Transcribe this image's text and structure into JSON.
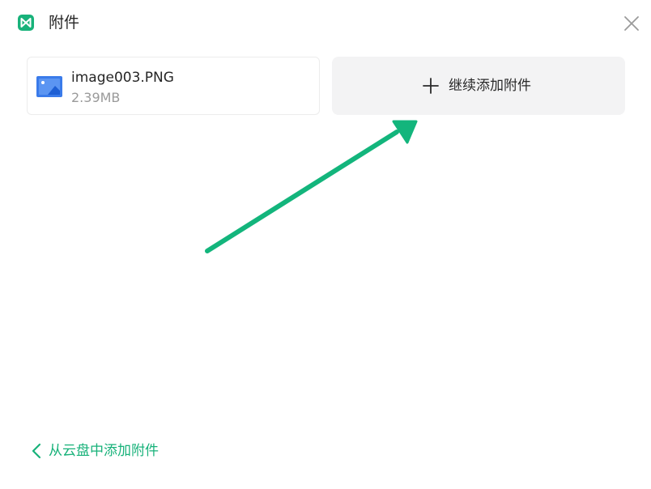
{
  "window": {
    "title": "附件",
    "logo_icon": "app-logo-icon",
    "close_icon": "close-icon",
    "brand_color": "#18b27a"
  },
  "attachment": {
    "file_name": "image003.PNG",
    "file_size": "2.39MB",
    "icon": "image-file-icon"
  },
  "add_button": {
    "label": "继续添加附件",
    "icon": "plus-icon"
  },
  "annotation": {
    "type": "arrow",
    "color": "#13b57c",
    "points_to": "add-attachment-button"
  },
  "footer": {
    "cloud_link_label": "从云盘中添加附件",
    "icon": "chevron-left-icon"
  }
}
